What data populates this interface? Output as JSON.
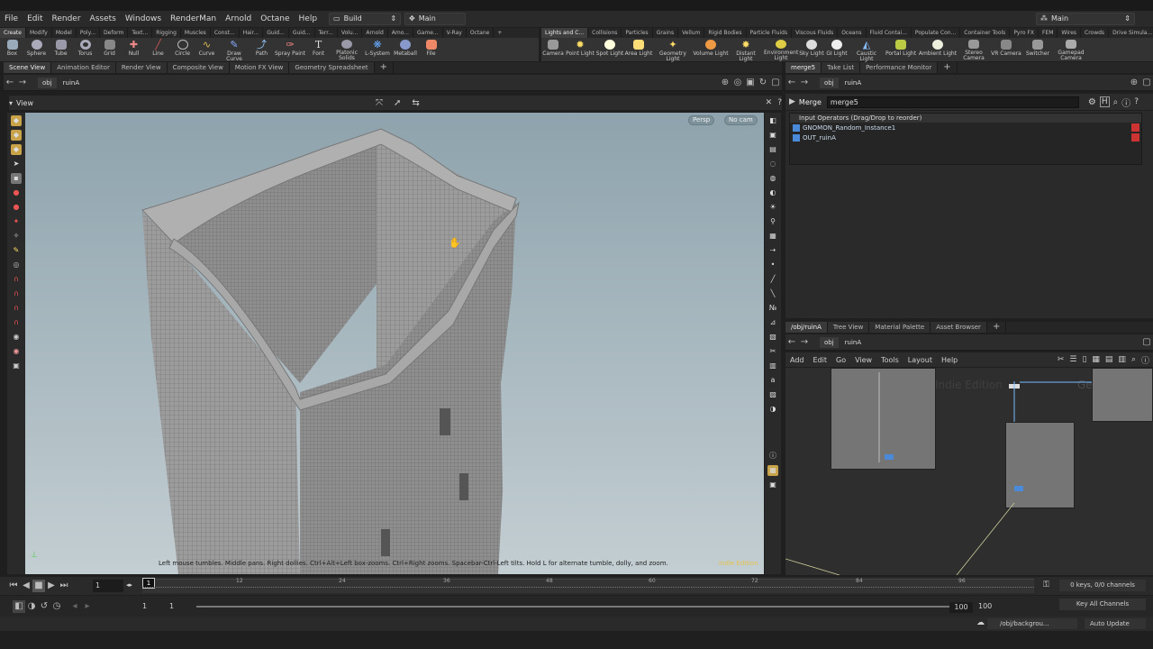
{
  "menubar": {
    "items": [
      "File",
      "Edit",
      "Render",
      "Assets",
      "Windows",
      "RenderMan",
      "Arnold",
      "Octane",
      "Help"
    ],
    "desktop": "Build",
    "context": "Main",
    "desktop_right": "Main"
  },
  "shelf": {
    "tabs": [
      "Create",
      "Modify",
      "Model",
      "Poly...",
      "Deform",
      "Text...",
      "Rigging",
      "Muscles",
      "Const...",
      "Hair...",
      "Guid...",
      "Guid...",
      "Terr...",
      "Volu...",
      "Arnold",
      "Amo...",
      "Game...",
      "V-Ray",
      "Octane"
    ],
    "tools": [
      "Box",
      "Sphere",
      "Tube",
      "Torus",
      "Grid",
      "Null",
      "Line",
      "Circle",
      "Curve",
      "Draw Curve",
      "Path",
      "Spray Paint",
      "Font",
      "Platonic Solids",
      "L-System",
      "Metaball",
      "File"
    ],
    "tabs2": [
      "Lights and C...",
      "Collisions",
      "Particles",
      "Grains",
      "Vellum",
      "Rigid Bodies",
      "Particle Fluids",
      "Viscous Fluids",
      "Oceans",
      "Fluid Contai...",
      "Populate Con...",
      "Container Tools",
      "Pyro FX",
      "FEM",
      "Wires",
      "Crowds",
      "Drive Simula..."
    ],
    "tools2": [
      "Camera",
      "Point Light",
      "Spot Light",
      "Area Light",
      "Geometry Light",
      "Volume Light",
      "Distant Light",
      "Environment Light",
      "Sky Light",
      "GI Light",
      "Caustic Light",
      "Portal Light",
      "Ambient Light",
      "Stereo Camera",
      "VR Camera",
      "Switcher",
      "Gamepad Camera"
    ]
  },
  "left_pane": {
    "tabs": [
      "Scene View",
      "Animation Editor",
      "Render View",
      "Composite View",
      "Motion FX View",
      "Geometry Spreadsheet"
    ],
    "path": [
      "obj",
      "ruinA"
    ],
    "view_label": "View",
    "persp": "Persp",
    "cam": "No cam",
    "hint": "Left mouse tumbles. Middle pans. Right dollies. Ctrl+Alt+Left box-zooms. Ctrl+Right zooms. Spacebar-Ctrl-Left tilts. Hold L for alternate tumble, dolly, and zoom.",
    "edition": "Indie Edition"
  },
  "param_pane": {
    "tabs": [
      "merge5",
      "Take List",
      "Performance Monitor"
    ],
    "path": [
      "obj",
      "ruinA"
    ],
    "node_type": "Merge",
    "node_name": "merge5",
    "section": "Input Operators (Drag/Drop to reorder)",
    "inputs": [
      "GNOMON_Random_Instance1",
      "OUT_ruinA"
    ]
  },
  "network_pane": {
    "tabs": [
      "/obj/ruinA",
      "Tree View",
      "Material Palette",
      "Asset Browser"
    ],
    "path": [
      "obj",
      "ruinA"
    ],
    "menu": [
      "Add",
      "Edit",
      "Go",
      "View",
      "Tools",
      "Layout",
      "Help"
    ],
    "watermark": "Indie Edition",
    "watermark2": "Geometry"
  },
  "timeline": {
    "frame": "1",
    "ticks": [
      "12",
      "24",
      "36",
      "48",
      "60",
      "72",
      "84",
      "96"
    ],
    "tick_marker": "1",
    "keys": "0 keys, 0/0 channels",
    "key_all": "Key All Channels",
    "start": "1",
    "start2": "1",
    "end": "100",
    "end2": "100"
  },
  "status": {
    "path": "/obj/backgrou...",
    "update": "Auto Update"
  },
  "colors": {
    "accent": "#e8c24a",
    "viewport_top": "#8ea3ad",
    "viewport_bottom": "#c3ced2"
  }
}
